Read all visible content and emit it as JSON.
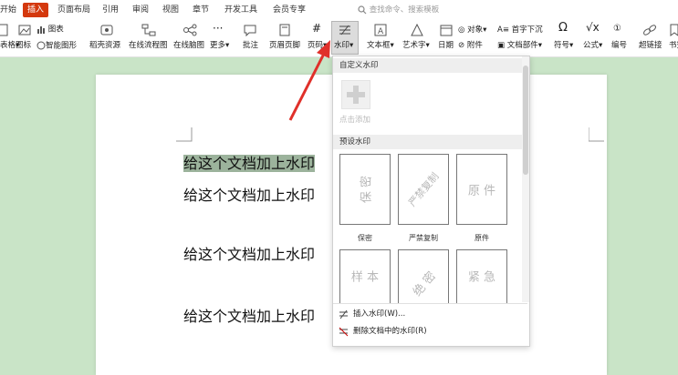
{
  "menu": {
    "tabs": [
      {
        "label": "开始",
        "active": false
      },
      {
        "label": "插入",
        "active": true
      },
      {
        "label": "页面布局",
        "active": false
      },
      {
        "label": "引用",
        "active": false
      },
      {
        "label": "审阅",
        "active": false
      },
      {
        "label": "视图",
        "active": false
      },
      {
        "label": "章节",
        "active": false
      },
      {
        "label": "开发工具",
        "active": false
      },
      {
        "label": "会员专享",
        "active": false
      }
    ],
    "search_placeholder": "查找命令、搜索模板"
  },
  "ribbon": {
    "items": [
      {
        "label": "表格",
        "icon": "table-icon"
      },
      {
        "label": "图标",
        "icon": "image-icon"
      },
      {
        "label": "图表",
        "icon": "chart-icon"
      },
      {
        "label": "智能图形",
        "icon": "smartart-icon"
      },
      {
        "label": "稻壳资源",
        "icon": "resource-icon"
      },
      {
        "label": "在线流程图",
        "icon": "flowchart-icon"
      },
      {
        "label": "在线脑图",
        "icon": "mindmap-icon"
      },
      {
        "label": "更多",
        "icon": "more-icon"
      },
      {
        "label": "批注",
        "icon": "comment-icon"
      },
      {
        "label": "页眉页脚",
        "icon": "header-footer-icon"
      },
      {
        "label": "页码",
        "icon": "page-number-icon"
      },
      {
        "label": "水印",
        "icon": "watermark-icon"
      },
      {
        "label": "文本框",
        "icon": "textbox-icon"
      },
      {
        "label": "艺术字",
        "icon": "wordart-icon"
      },
      {
        "label": "日期",
        "icon": "date-icon"
      },
      {
        "label": "对象",
        "icon": "object-icon"
      },
      {
        "label": "附件",
        "icon": "attachment-icon"
      },
      {
        "label": "首字下沉",
        "icon": "dropcap-icon"
      },
      {
        "label": "文档部件",
        "icon": "parts-icon"
      },
      {
        "label": "符号",
        "icon": "symbol-icon"
      },
      {
        "label": "公式",
        "icon": "formula-icon"
      },
      {
        "label": "编号",
        "icon": "numbering-icon"
      },
      {
        "label": "超链接",
        "icon": "link-icon"
      },
      {
        "label": "书签",
        "icon": "bookmark-icon"
      }
    ]
  },
  "document": {
    "lines": [
      "给这个文档加上水印",
      "给这个文档加上水印",
      "给这个文档加上水印",
      "给这个文档加上水印"
    ]
  },
  "watermark_panel": {
    "custom_title": "自定义水印",
    "add_label": "点击添加",
    "preset_title": "预设水印",
    "presets": [
      {
        "text": "保 密",
        "caption": "保密",
        "angle": "vertical"
      },
      {
        "text": "严禁复制",
        "caption": "严禁复制",
        "angle": "diagonal"
      },
      {
        "text": "原 件",
        "caption": "原件",
        "angle": "horizontal"
      },
      {
        "text": "样 本",
        "caption": "",
        "angle": "horizontal"
      },
      {
        "text": "绝 密",
        "caption": "",
        "angle": "diagonal"
      },
      {
        "text": "紧 急",
        "caption": "",
        "angle": "horizontal"
      }
    ],
    "insert_label": "插入水印(W)...",
    "delete_label": "删除文档中的水印(R)"
  },
  "colors": {
    "accent": "#d4380d",
    "doc_background": "#c9e4c7",
    "highlight": "#9cb39c",
    "arrow": "#e0302a"
  }
}
